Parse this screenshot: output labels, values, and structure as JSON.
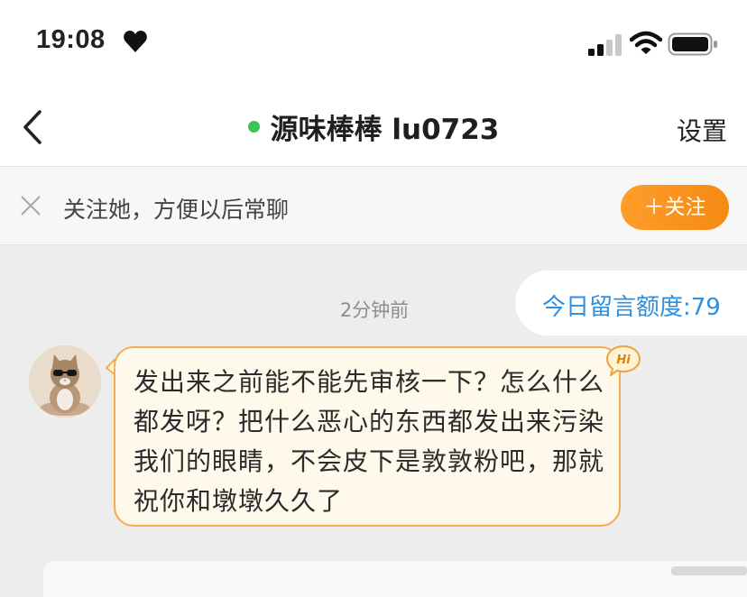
{
  "status_bar": {
    "time": "19:08"
  },
  "nav": {
    "title": "源味棒棒 lu0723",
    "settings_label": "设置"
  },
  "follow_bar": {
    "text": "关注她，方便以后常聊",
    "button_label": "＋关注"
  },
  "chat": {
    "quota": "今日留言额度:79",
    "timestamp": "2分钟前",
    "message": "发出来之前能不能先审核一下？怎么什么都发呀？把什么恶心的东西都发出来污染我们的眼睛，不会皮下是敦敦粉吧，那就祝你和墩墩久久了",
    "badge": "Hi"
  },
  "colors": {
    "accent_orange": "#f58a12",
    "online_green": "#3bc45a",
    "quota_blue": "#2f8fe0",
    "bubble_border": "#f4ad52",
    "bubble_bg": "#fff9ec"
  },
  "icons": {
    "back": "chevron-left-icon",
    "close": "close-icon",
    "heart": "heart-icon",
    "signal": "cellular-signal-icon",
    "wifi": "wifi-icon",
    "battery": "battery-icon"
  }
}
